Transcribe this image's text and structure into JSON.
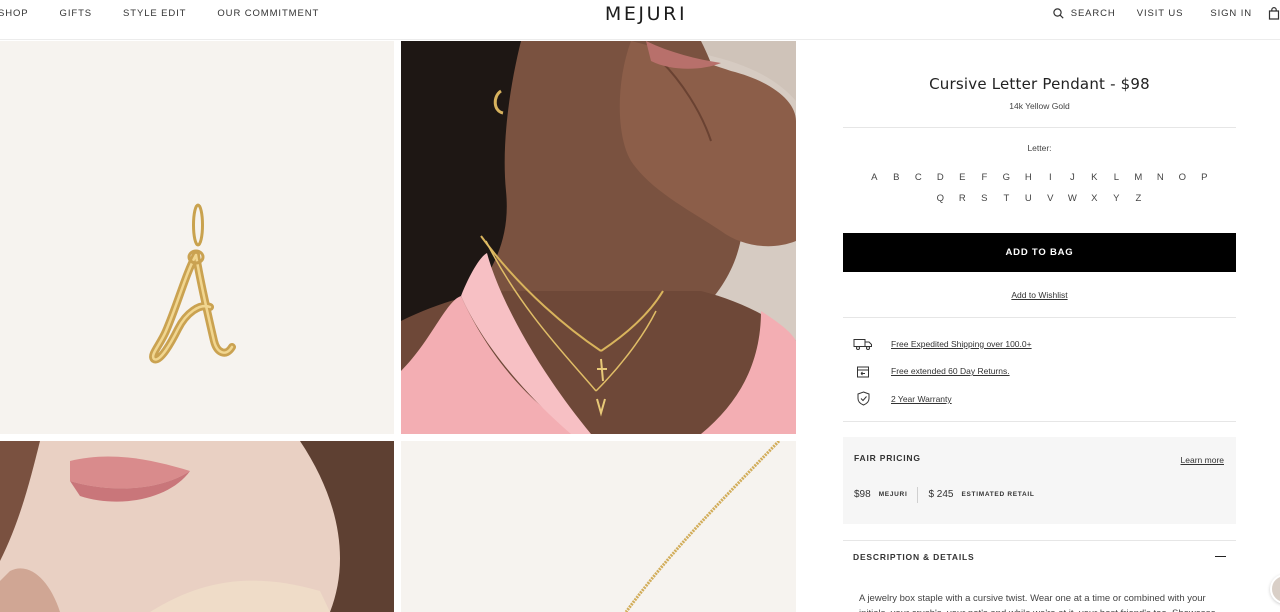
{
  "header": {
    "logo": "MEJURI",
    "nav_left": [
      "SHOP",
      "GIFTS",
      "STYLE EDIT",
      "OUR COMMITMENT"
    ],
    "search_label": "SEARCH",
    "visit_label": "VISIT US",
    "signin_label": "SIGN IN"
  },
  "product": {
    "title": "Cursive Letter Pendant - $98",
    "material": "14k Yellow Gold",
    "letter_label": "Letter:",
    "letters": [
      "A",
      "B",
      "C",
      "D",
      "E",
      "F",
      "G",
      "H",
      "I",
      "J",
      "K",
      "L",
      "M",
      "N",
      "O",
      "P",
      "Q",
      "R",
      "S",
      "T",
      "U",
      "V",
      "W",
      "X",
      "Y",
      "Z"
    ],
    "add_to_bag": "ADD TO BAG",
    "wishlist": "Add to Wishlist"
  },
  "perks": [
    {
      "icon": "truck-icon",
      "text": "Free Expedited Shipping over 100.0+"
    },
    {
      "icon": "return-box-icon",
      "text": "Free extended 60 Day Returns."
    },
    {
      "icon": "shield-check-icon",
      "text": "2 Year Warranty"
    }
  ],
  "fair_pricing": {
    "title": "FAIR PRICING",
    "learn_more": "Learn more",
    "mejuri_price": "$98",
    "mejuri_tag": "MEJURI",
    "retail_price": "$ 245",
    "retail_tag": "ESTIMATED RETAIL"
  },
  "description": {
    "title": "DESCRIPTION & DETAILS",
    "text": "A jewelry box staple with a cursive twist. Wear one at a time or combined with your initials, your crush's, your pet's and while we're at it, your best friend's too. Showcase your favorites"
  },
  "colors": {
    "accent": "#000000",
    "gold": "#d4a94f",
    "panel_bg": "#f6f6f6"
  }
}
